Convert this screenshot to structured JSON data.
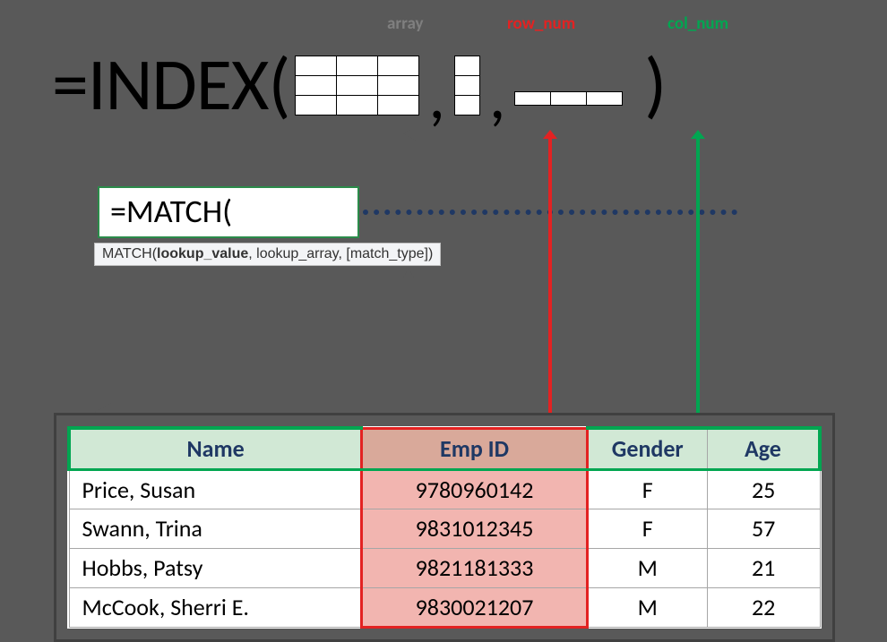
{
  "labels": {
    "array": "array",
    "row_num": "row_num",
    "col_num": "col_num"
  },
  "colors": {
    "array_label": "#7f7f7f",
    "row_label": "#e32222",
    "col_label": "#00a651"
  },
  "formula": {
    "prefix": "=INDEX(",
    "comma": ",",
    "close": ")"
  },
  "match": {
    "cell_text": "=MATCH(",
    "tooltip_prefix": "MATCH(",
    "tooltip_bold": "lookup_value",
    "tooltip_rest": ", lookup_array, [match_type])"
  },
  "table": {
    "headers": [
      "Name",
      "Emp ID",
      "Gender",
      "Age"
    ],
    "rows": [
      {
        "name": "Price, Susan",
        "emp": "9780960142",
        "gender": "F",
        "age": "25"
      },
      {
        "name": "Swann, Trina",
        "emp": "9831012345",
        "gender": "F",
        "age": "57"
      },
      {
        "name": "Hobbs, Patsy",
        "emp": "9821181333",
        "gender": "M",
        "age": "21"
      },
      {
        "name": "McCook, Sherri E.",
        "emp": "9830021207",
        "gender": "M",
        "age": "22"
      }
    ]
  }
}
